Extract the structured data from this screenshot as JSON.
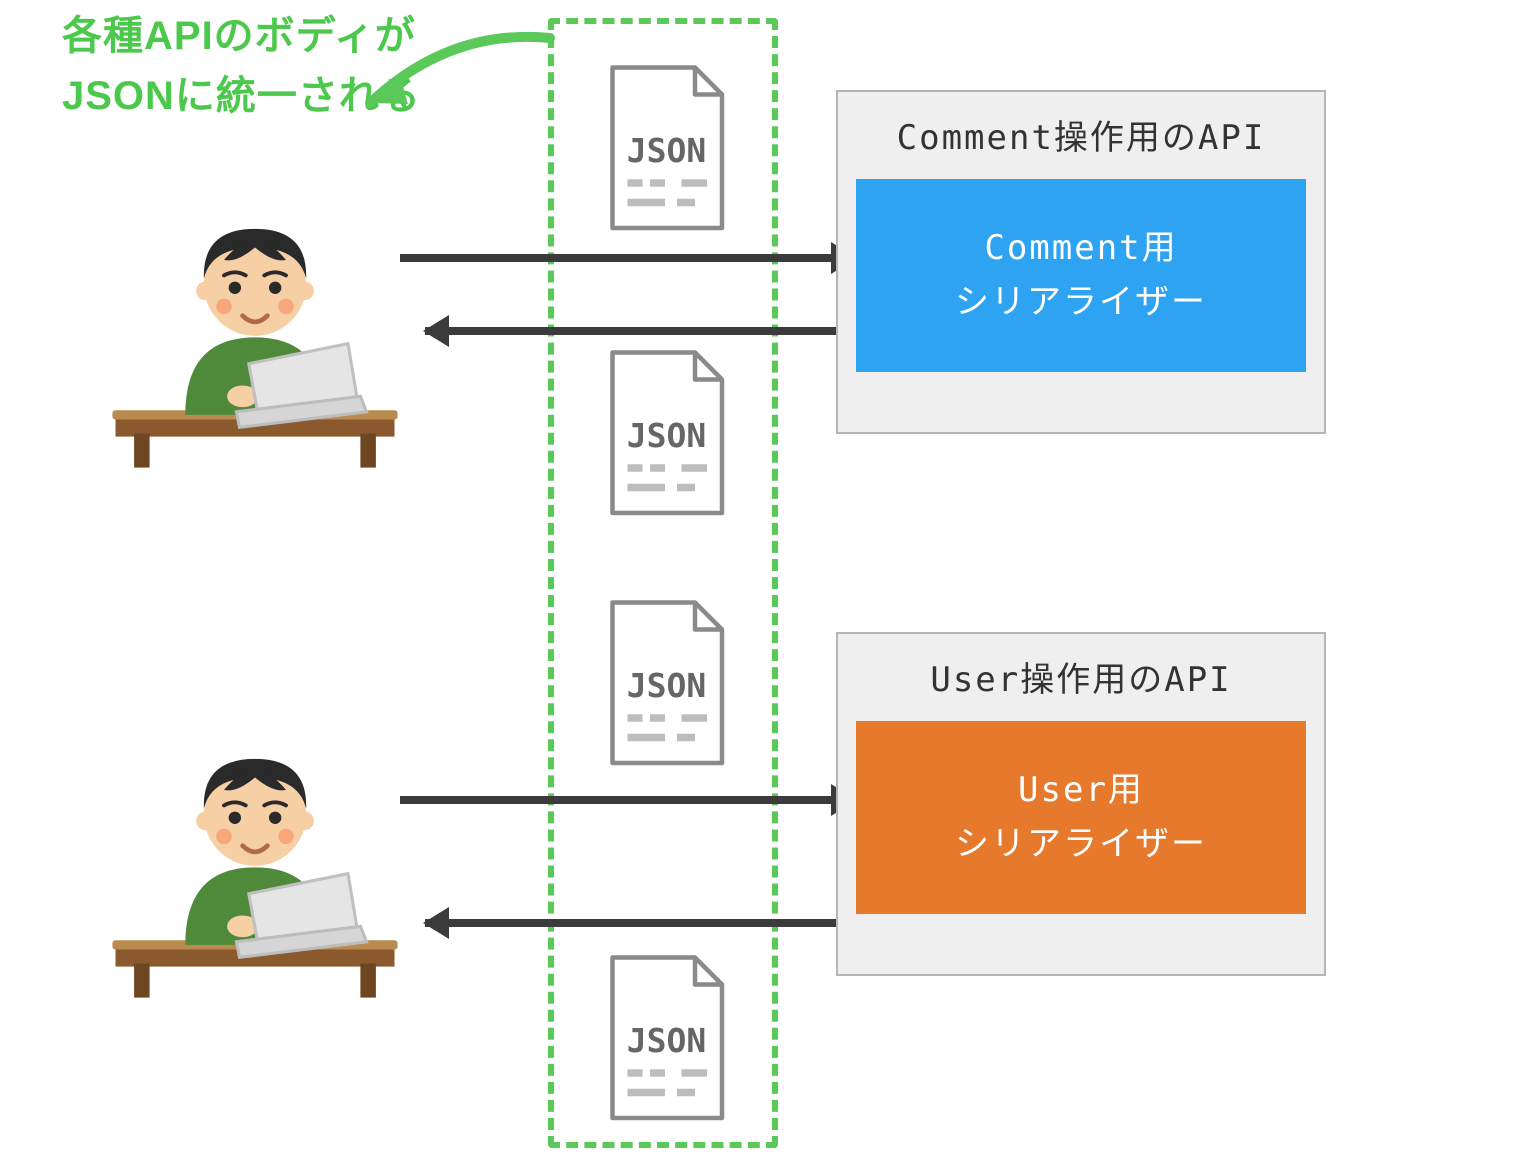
{
  "annotation": {
    "line1": "各種APIのボディが",
    "line2": "JSONに統一される"
  },
  "json_label": "JSON",
  "api1": {
    "title": "Comment操作用のAPI",
    "serializer_line1": "Comment用",
    "serializer_line2": "シリアライザー"
  },
  "api2": {
    "title": "User操作用のAPI",
    "serializer_line1": "User用",
    "serializer_line2": "シリアライザー"
  },
  "colors": {
    "green": "#5ac95a",
    "blue": "#2ea3f2",
    "orange": "#e6792b",
    "arrow": "#3b3b3b"
  }
}
